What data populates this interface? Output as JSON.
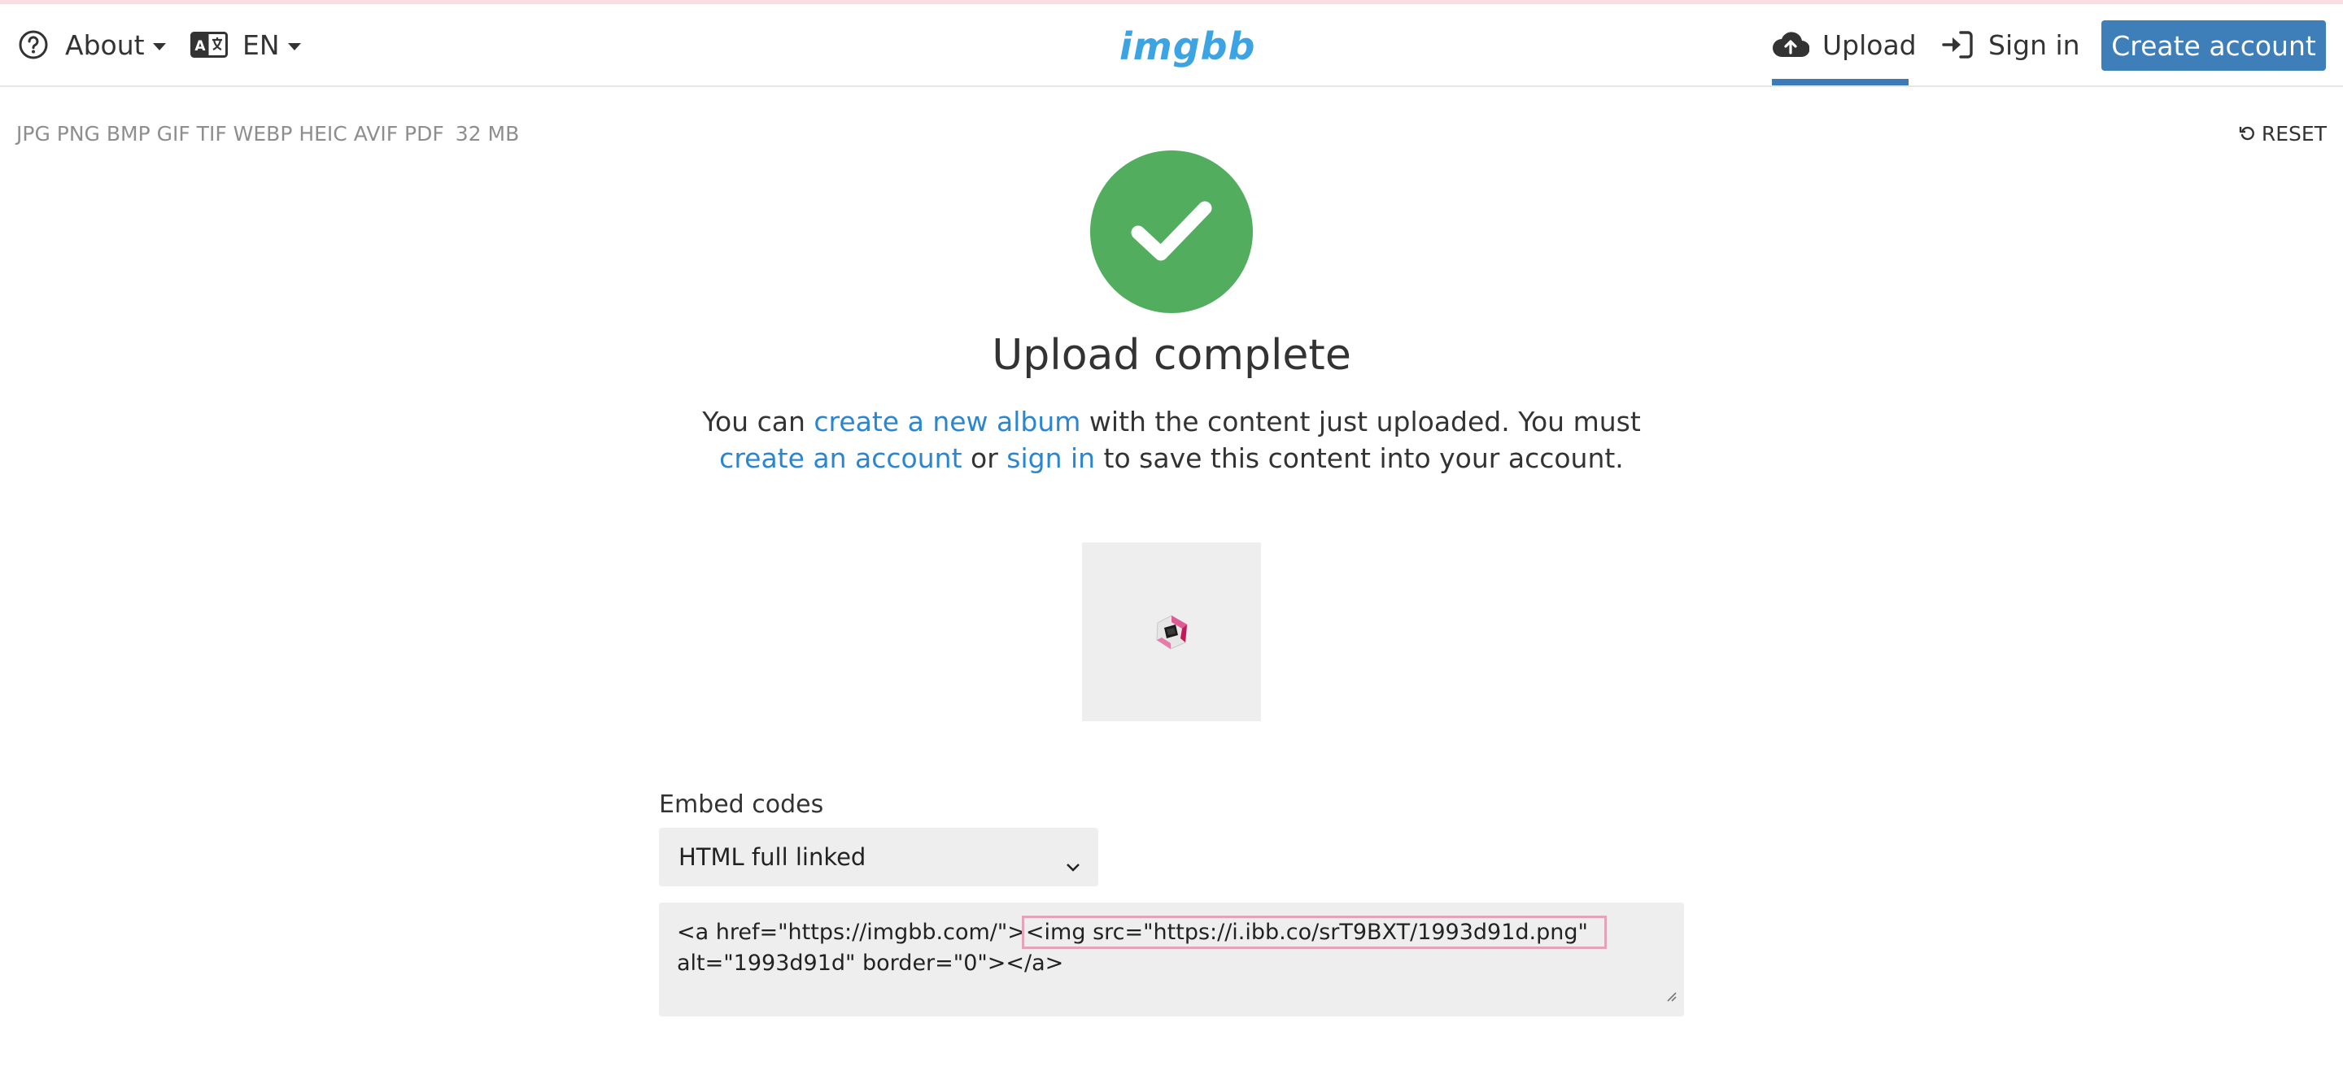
{
  "header": {
    "about_label": "About",
    "language_label": "EN",
    "logo_text": "imgbb",
    "upload_label": "Upload",
    "signin_label": "Sign in",
    "create_account_label": "Create account",
    "icons": [
      "question-circle-icon",
      "language-icon",
      "cloud-upload-icon",
      "sign-in-icon"
    ]
  },
  "subbar": {
    "formats": "JPG PNG BMP GIF TIF WEBP HEIC AVIF PDF",
    "max_size": "32 MB",
    "reset_label": "RESET"
  },
  "result": {
    "title": "Upload complete",
    "message": {
      "t1": "You can ",
      "link_album": "create a new album",
      "t2": " with the content just uploaded. You must ",
      "link_create": "create an account",
      "t3": " or ",
      "link_signin": "sign in",
      "t4": " to save this content into your account."
    }
  },
  "embed": {
    "label": "Embed codes",
    "selected_option": "HTML full linked",
    "code_part1": "<a href=\"https://imgbb.com/\">",
    "code_part2": "<img src=\"https://i.ibb.co/srT9BXT/1993d91d.png\"",
    "code_part3": "alt=\"1993d91d\" border=\"0\"></a>"
  },
  "colors": {
    "primary_button": "#3e7eb9",
    "link": "#2a86d1",
    "success": "#52ad5f",
    "logo": "#3da4e3"
  }
}
